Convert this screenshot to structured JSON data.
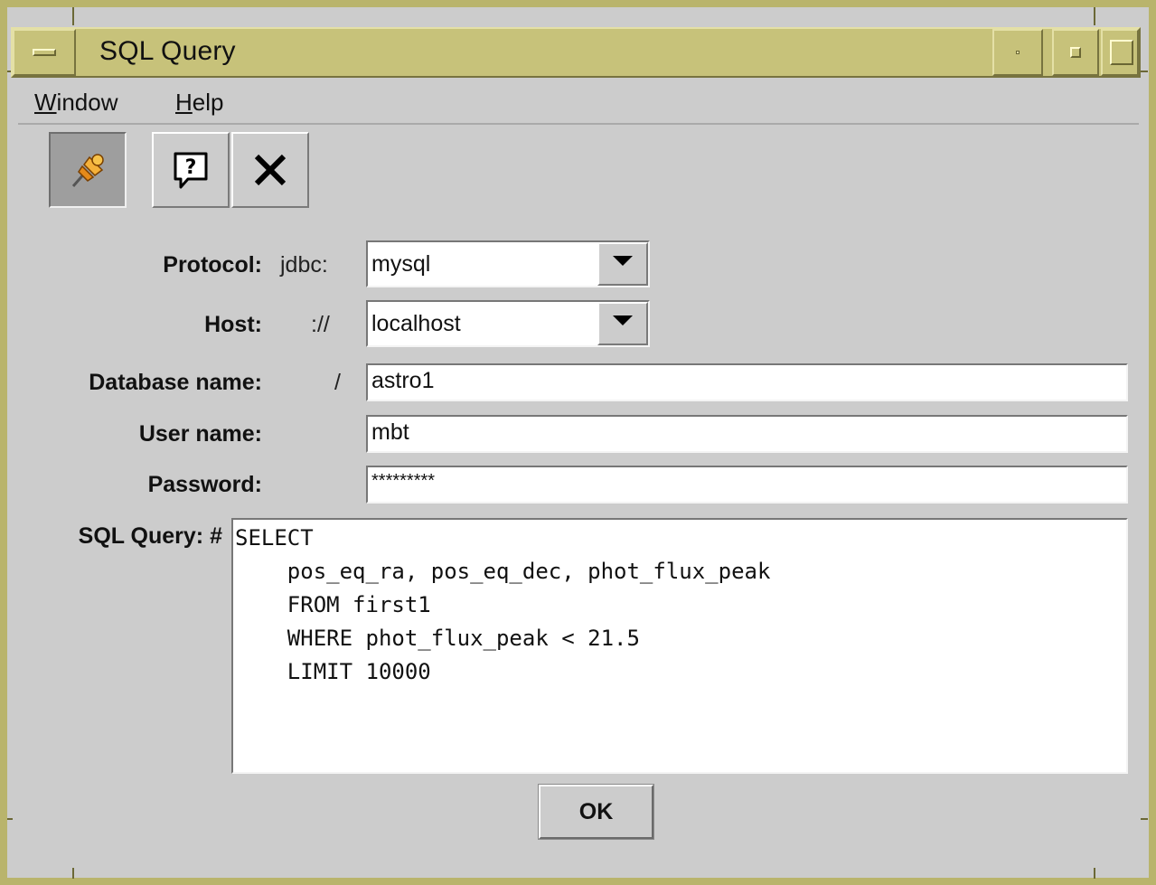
{
  "window": {
    "title": "SQL Query"
  },
  "menu": [
    {
      "label_first": "W",
      "label_rest": "indow"
    },
    {
      "label_first": "H",
      "label_rest": "elp"
    }
  ],
  "toolbar": {
    "pin_icon": "pushpin-icon",
    "help_icon": "help-icon",
    "close_icon": "close-icon"
  },
  "form": {
    "protocol": {
      "label": "Protocol:",
      "prefix": "jdbc:",
      "value": "mysql"
    },
    "host": {
      "label": "Host:",
      "prefix": "://",
      "value": "localhost"
    },
    "database": {
      "label": "Database name:",
      "prefix": "/",
      "value": "astro1"
    },
    "user": {
      "label": "User name:",
      "value": "mbt"
    },
    "password": {
      "label": "Password:",
      "value": "*********"
    },
    "query": {
      "label": "SQL Query: #",
      "lines": [
        "SELECT",
        "    pos_eq_ra, pos_eq_dec, phot_flux_peak",
        "    FROM first1",
        "    WHERE phot_flux_peak < 21.5",
        "    LIMIT 10000"
      ]
    },
    "ok_label": "OK"
  },
  "colors": {
    "frame": "#b9b46c",
    "titlebar": "#c7c27a",
    "panel": "#cccccc"
  }
}
